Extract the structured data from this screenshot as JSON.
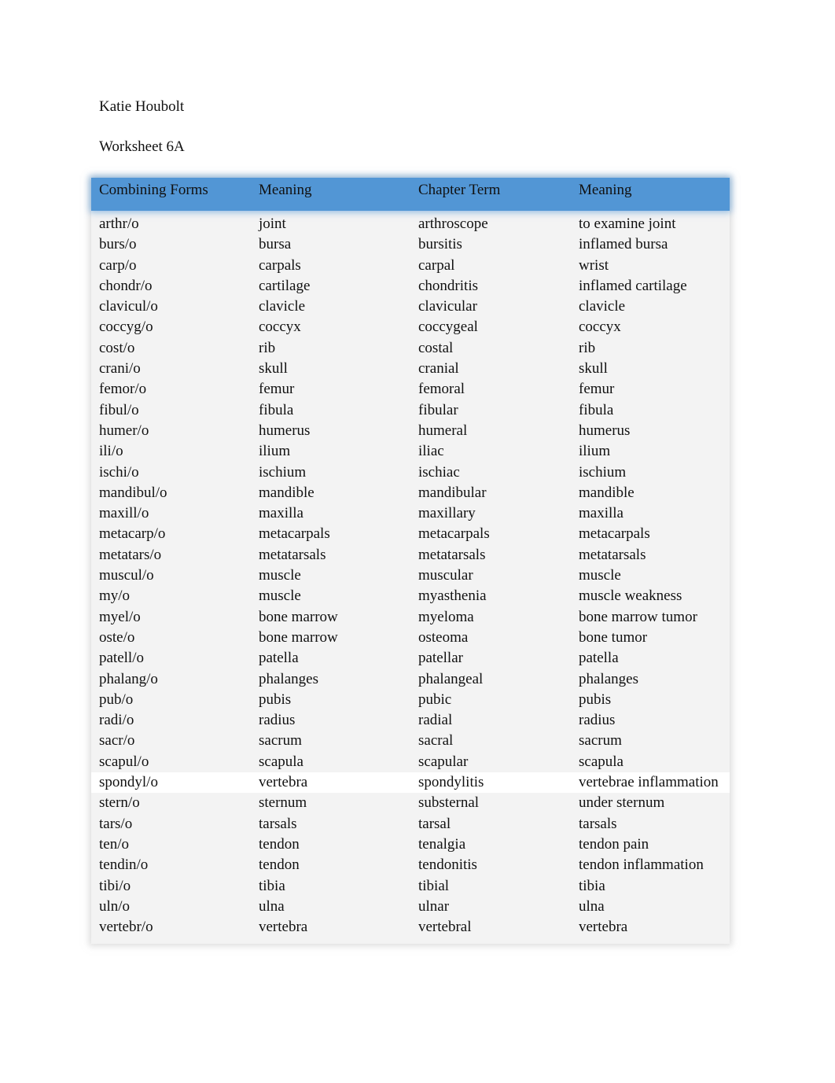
{
  "document": {
    "author": "Katie Houbolt",
    "title": "Worksheet 6A"
  },
  "table": {
    "headers": [
      "Combining Forms",
      "Meaning",
      "Chapter Term",
      "Meaning"
    ],
    "header_color": "#5296d5",
    "rows": [
      [
        "arthr/o",
        "joint",
        "arthroscope",
        "to examine joint"
      ],
      [
        "burs/o",
        "bursa",
        "bursitis",
        "inflamed bursa"
      ],
      [
        "carp/o",
        "carpals",
        "carpal",
        "wrist"
      ],
      [
        "chondr/o",
        "cartilage",
        "chondritis",
        "inflamed cartilage"
      ],
      [
        "clavicul/o",
        "clavicle",
        "clavicular",
        "clavicle"
      ],
      [
        "coccyg/o",
        "coccyx",
        "coccygeal",
        "coccyx"
      ],
      [
        "cost/o",
        "rib",
        "costal",
        "rib"
      ],
      [
        "crani/o",
        "skull",
        "cranial",
        "skull"
      ],
      [
        "femor/o",
        "femur",
        "femoral",
        "femur"
      ],
      [
        "fibul/o",
        "fibula",
        "fibular",
        "fibula"
      ],
      [
        "humer/o",
        "humerus",
        "humeral",
        "humerus"
      ],
      [
        "ili/o",
        "ilium",
        "iliac",
        "ilium"
      ],
      [
        "ischi/o",
        "ischium",
        "ischiac",
        "ischium"
      ],
      [
        "mandibul/o",
        "mandible",
        "mandibular",
        "mandible"
      ],
      [
        "maxill/o",
        "maxilla",
        "maxillary",
        "maxilla"
      ],
      [
        "metacarp/o",
        "metacarpals",
        "metacarpals",
        "metacarpals"
      ],
      [
        "metatars/o",
        "metatarsals",
        "metatarsals",
        "metatarsals"
      ],
      [
        "muscul/o",
        "muscle",
        "muscular",
        "muscle"
      ],
      [
        "my/o",
        "muscle",
        "myasthenia",
        "muscle weakness"
      ],
      [
        "myel/o",
        "bone marrow",
        "myeloma",
        "bone marrow tumor"
      ],
      [
        "oste/o",
        "bone marrow",
        "osteoma",
        "bone tumor"
      ],
      [
        "patell/o",
        "patella",
        "patellar",
        "patella"
      ],
      [
        "phalang/o",
        "phalanges",
        "phalangeal",
        "phalanges"
      ],
      [
        "pub/o",
        "pubis",
        "pubic",
        "pubis"
      ],
      [
        "radi/o",
        "radius",
        "radial",
        "radius"
      ],
      [
        "sacr/o",
        "sacrum",
        "sacral",
        "sacrum"
      ],
      [
        "scapul/o",
        "scapula",
        "scapular",
        "scapula"
      ],
      [
        "spondyl/o",
        "vertebra",
        "spondylitis",
        "vertebrae inflammation"
      ],
      [
        "stern/o",
        "sternum",
        "substernal",
        "under sternum"
      ],
      [
        "tars/o",
        "tarsals",
        "tarsal",
        "tarsals"
      ],
      [
        "ten/o",
        "tendon",
        "tenalgia",
        "tendon pain"
      ],
      [
        "tendin/o",
        "tendon",
        "tendonitis",
        "tendon inflammation"
      ],
      [
        "tibi/o",
        "tibia",
        "tibial",
        "tibia"
      ],
      [
        "uln/o",
        "ulna",
        "ulnar",
        "ulna"
      ],
      [
        "vertebr/o",
        "vertebra",
        "vertebral",
        "vertebra"
      ]
    ]
  }
}
